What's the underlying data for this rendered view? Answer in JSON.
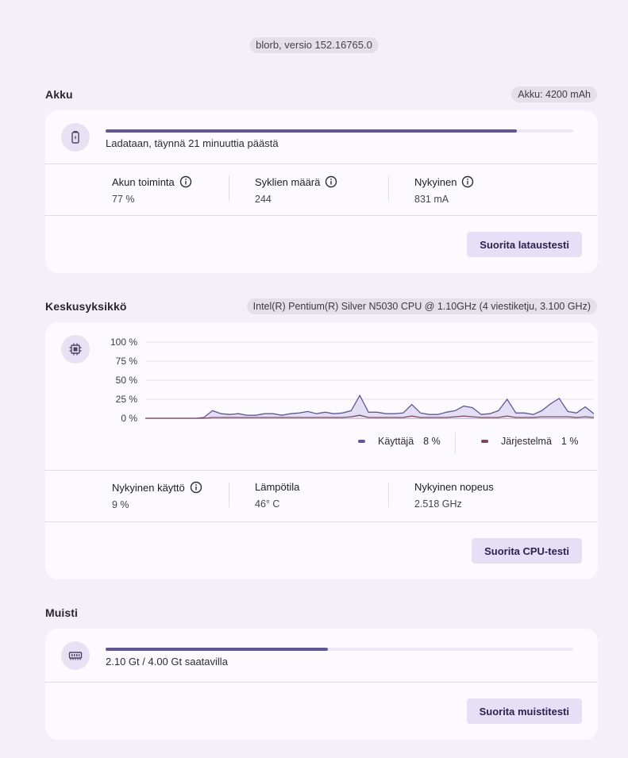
{
  "app": {
    "version": "blorb, versio 152.16765.0"
  },
  "battery": {
    "title": "Akku",
    "capacity": "Akku: 4200 mAh",
    "status": "Ladataan, täynnä 21 minuuttia päästä",
    "charge_fraction": 0.88,
    "stats": [
      {
        "label": "Akun toiminta",
        "value": "77 %"
      },
      {
        "label": "Syklien määrä",
        "value": "244"
      },
      {
        "label": "Nykyinen",
        "value": "831 mA"
      }
    ],
    "action": "Suorita lataustesti"
  },
  "cpu": {
    "title": "Keskusyksikkö",
    "model": "Intel(R) Pentium(R) Silver N5030 CPU @ 1.10GHz (4 viestiketju, 3.100 GHz)",
    "legend": {
      "user_label": "Käyttäjä",
      "user_value": "8 %",
      "system_label": "Järjestelmä",
      "system_value": "1 %"
    },
    "stats": [
      {
        "label": "Nykyinen käyttö",
        "value": "9 %"
      },
      {
        "label": "Lämpötila",
        "value": "46° C"
      },
      {
        "label": "Nykyinen nopeus",
        "value": "2.518 GHz"
      }
    ],
    "action": "Suorita CPU-testi"
  },
  "memory": {
    "title": "Muisti",
    "status": "2.10 Gt / 4.00 Gt saatavilla",
    "used_fraction": 0.475,
    "action": "Suorita muistitesti"
  },
  "chart_data": {
    "type": "area",
    "ylabel": "",
    "ylim": [
      0,
      100
    ],
    "yticks": [
      "100 %",
      "75 %",
      "50 %",
      "25 %",
      "0 %"
    ],
    "colors": {
      "user": "#5f5794",
      "system": "#7a4a5a",
      "user_fill": "#e4def4"
    },
    "series": [
      {
        "name": "Käyttäjä",
        "values": [
          0,
          0,
          0,
          0,
          1,
          10,
          6,
          5,
          6,
          4,
          4,
          6,
          6,
          4,
          6,
          7,
          9,
          6,
          8,
          6,
          7,
          10,
          30,
          8,
          8,
          6,
          6,
          7,
          18,
          7,
          5,
          5,
          8,
          10,
          16,
          14,
          5,
          6,
          10,
          25,
          7,
          7,
          5,
          10,
          19,
          26,
          9,
          7,
          15,
          6
        ]
      },
      {
        "name": "Järjestelmä",
        "values": [
          0,
          0,
          0,
          0,
          0,
          1,
          1,
          1,
          1,
          1,
          1,
          1,
          1,
          1,
          1,
          1,
          1,
          1,
          1,
          1,
          1,
          2,
          4,
          1,
          1,
          1,
          1,
          1,
          3,
          1,
          1,
          1,
          1,
          2,
          3,
          2,
          1,
          1,
          1,
          3,
          1,
          1,
          1,
          2,
          2,
          2,
          2,
          1,
          2,
          1
        ]
      }
    ]
  }
}
